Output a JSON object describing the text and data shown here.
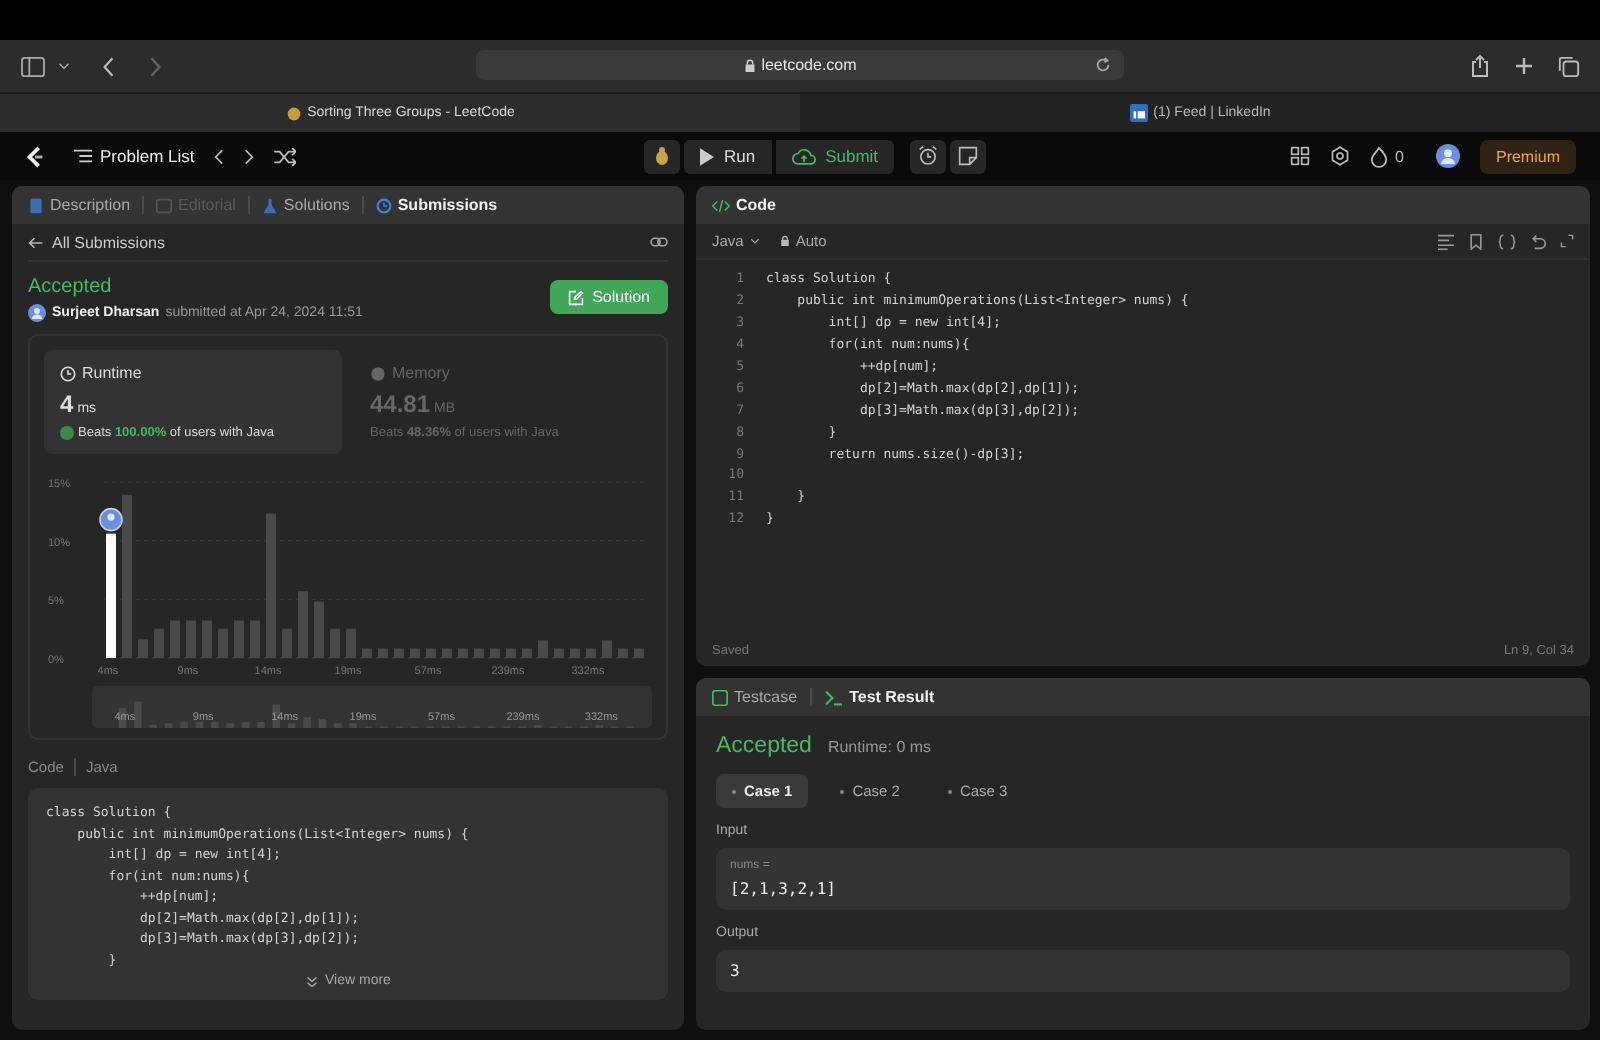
{
  "browser": {
    "url": "leetcode.com",
    "tabs": [
      {
        "title": "Sorting Three Groups - LeetCode",
        "selected": true
      },
      {
        "title": "(1) Feed | LinkedIn",
        "selected": false
      }
    ]
  },
  "nav": {
    "problem_list": "Problem List",
    "run": "Run",
    "submit": "Submit",
    "streak": "0",
    "premium": "Premium"
  },
  "left": {
    "tabs": [
      {
        "label": "Description",
        "selected": false,
        "disabled": false
      },
      {
        "label": "Editorial",
        "selected": false,
        "disabled": true
      },
      {
        "label": "Solutions",
        "selected": false,
        "disabled": false
      },
      {
        "label": "Submissions",
        "selected": true,
        "disabled": false
      }
    ],
    "back": "All Submissions",
    "status": "Accepted",
    "user": "Surjeet Dharsan",
    "submitted": "submitted at Apr 24, 2024 11:51",
    "solution_button": "Solution",
    "cards": [
      {
        "title": "Runtime",
        "value": "4",
        "unit": "ms",
        "beats_prefix": "Beats",
        "beats": "100.00%",
        "beats_suffix": "of users with Java",
        "selected": true
      },
      {
        "title": "Memory",
        "value": "44.81",
        "unit": "MB",
        "beats_prefix": "Beats",
        "beats": "48.36%",
        "beats_suffix": "of users with Java",
        "selected": false
      }
    ],
    "chart_data": {
      "type": "bar",
      "categories": [
        "4ms",
        null,
        null,
        null,
        null,
        "9ms",
        null,
        null,
        null,
        null,
        "14ms",
        null,
        null,
        null,
        null,
        "19ms",
        null,
        null,
        null,
        null,
        "57ms",
        null,
        null,
        null,
        null,
        "239ms",
        null,
        null,
        null,
        null,
        "332ms",
        null,
        null,
        null
      ],
      "values": [
        10.6,
        13.9,
        1.6,
        2.5,
        3.2,
        3.2,
        3.2,
        2.5,
        3.2,
        3.2,
        12.3,
        2.5,
        5.7,
        4.8,
        2.5,
        2.5,
        0.8,
        0.8,
        0.8,
        0.8,
        0.8,
        0.8,
        0.8,
        0.8,
        0.8,
        0.8,
        0.8,
        1.5,
        0.8,
        0.8,
        0.8,
        1.5,
        0.8,
        0.8
      ],
      "ylim": [
        0,
        15
      ],
      "yticks": [
        {
          "value": 0,
          "label": "0%"
        },
        {
          "value": 5,
          "label": "5%"
        },
        {
          "value": 10,
          "label": "10%"
        },
        {
          "value": 15,
          "label": "15%"
        }
      ]
    },
    "bar_selected": [
      true,
      false,
      false,
      false,
      false,
      false,
      false,
      false,
      false,
      false,
      false,
      false,
      false,
      false,
      false,
      false,
      false,
      false,
      false,
      false,
      false,
      false,
      false,
      false,
      false,
      false,
      false,
      false,
      false,
      false,
      false,
      false,
      false,
      false
    ],
    "navigator_labels": [
      "4ms",
      "9ms",
      "14ms",
      "19ms",
      "57ms",
      "239ms",
      "332ms"
    ],
    "code_label": "Code",
    "code_language": "Java",
    "code": [
      "class Solution {",
      "    public int minimumOperations(List<Integer> nums) {",
      "        int[] dp = new int[4];",
      "        for(int num:nums){",
      "            ++dp[num];",
      "            dp[2]=Math.max(dp[2],dp[1]);",
      "            dp[3]=Math.max(dp[3],dp[2]);",
      "        }"
    ],
    "view_more": "View more"
  },
  "editor": {
    "title": "Code",
    "language": "Java",
    "mode": "Auto",
    "lines": [
      {
        "n": "1",
        "text": "class Solution {"
      },
      {
        "n": "2",
        "text": "    public int minimumOperations(List<Integer> nums) {"
      },
      {
        "n": "3",
        "text": "        int[] dp = new int[4];"
      },
      {
        "n": "4",
        "text": "        for(int num:nums){"
      },
      {
        "n": "5",
        "text": "            ++dp[num];"
      },
      {
        "n": "6",
        "text": "            dp[2]=Math.max(dp[2],dp[1]);"
      },
      {
        "n": "7",
        "text": "            dp[3]=Math.max(dp[3],dp[2]);"
      },
      {
        "n": "8",
        "text": "        }"
      },
      {
        "n": "9",
        "text": "        return nums.size()-dp[3];"
      },
      {
        "n": "10"
      },
      {
        "n": "11",
        "text": "    }"
      },
      {
        "n": "12",
        "text": "}"
      }
    ],
    "status": "Saved",
    "cursor": "Ln 9, Col 34"
  },
  "console": {
    "tabs": [
      {
        "label": "Testcase",
        "selected": false
      },
      {
        "label": "Test Result",
        "selected": true
      }
    ],
    "status": "Accepted",
    "runtime": "Runtime: 0 ms",
    "cases": [
      {
        "label": "Case 1",
        "selected": true
      },
      {
        "label": "Case 2",
        "selected": false
      },
      {
        "label": "Case 3",
        "selected": false
      }
    ],
    "input_label": "Input",
    "param": "nums =",
    "input_value": "[2,1,3,2,1]",
    "output_label": "Output",
    "output_value": "3"
  }
}
